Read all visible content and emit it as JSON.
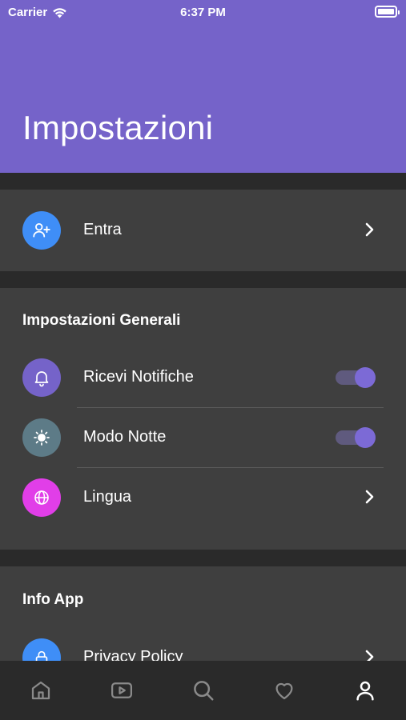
{
  "status_bar": {
    "carrier": "Carrier",
    "time": "6:37 PM",
    "wifi_icon": "wifi-icon",
    "battery_icon": "battery-icon"
  },
  "header": {
    "title": "Impostazioni",
    "color": "#7563c9"
  },
  "account": {
    "login_label": "Entra",
    "icon": "user-plus-icon",
    "icon_color": "#3f8ef7"
  },
  "general": {
    "section_title": "Impostazioni Generali",
    "items": [
      {
        "label": "Ricevi Notifiche",
        "icon": "bell-icon",
        "icon_color": "#7563c9",
        "control": "toggle",
        "enabled": true
      },
      {
        "label": "Modo Notte",
        "icon": "sun-icon",
        "icon_color": "#5d7b87",
        "control": "toggle",
        "enabled": true
      },
      {
        "label": "Lingua",
        "icon": "globe-icon",
        "icon_color": "#e13ee8",
        "control": "chevron"
      }
    ]
  },
  "info": {
    "section_title": "Info App",
    "items": [
      {
        "label": "Privacy Policy",
        "icon": "lock-icon",
        "icon_color": "#3f8ef7",
        "control": "chevron"
      }
    ]
  },
  "tab_bar": {
    "tabs": [
      {
        "icon": "home-icon",
        "active": false
      },
      {
        "icon": "video-icon",
        "active": false
      },
      {
        "icon": "search-icon",
        "active": false
      },
      {
        "icon": "heart-icon",
        "active": false
      },
      {
        "icon": "profile-icon",
        "active": true
      }
    ]
  },
  "colors": {
    "background": "#2a2a2a",
    "card": "#3f3f3f",
    "accent": "#7c6ad6",
    "inactive_icon": "#8a8a8a"
  }
}
